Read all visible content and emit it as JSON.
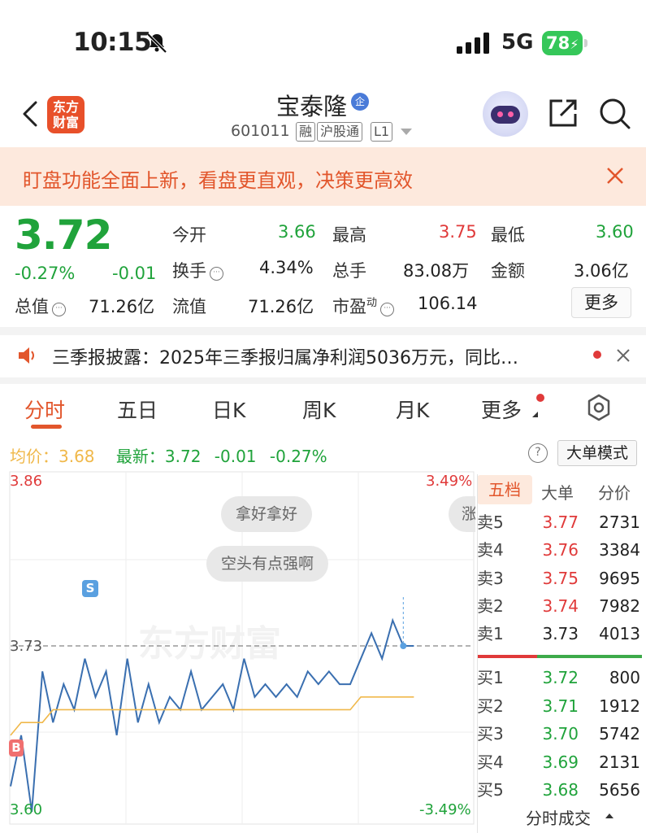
{
  "status_bar": {
    "time": "10:15",
    "network": "5G",
    "battery": "78"
  },
  "header": {
    "logo_text_line1": "东方",
    "logo_text_line2": "财富",
    "stock_name": "宝泰隆",
    "name_badge": "企",
    "stock_code": "601011",
    "tags": [
      "融",
      "沪股通",
      "L1"
    ]
  },
  "banner": {
    "text": "盯盘功能全面上新，看盘更直观，决策更高效"
  },
  "quote": {
    "price": "3.72",
    "change_pct": "-0.27%",
    "change": "-0.01",
    "open_label": "今开",
    "open": "3.66",
    "high_label": "最高",
    "high": "3.75",
    "low_label": "最低",
    "low": "3.60",
    "turnover_label": "换手",
    "turnover": "4.34%",
    "volume_label": "总手",
    "volume": "83.08万",
    "amount_label": "金额",
    "amount": "3.06亿",
    "total_cap_label": "总值",
    "total_cap": "71.26亿",
    "float_cap_label": "流值",
    "float_cap": "71.26亿",
    "pe_label": "市盈",
    "pe_sup": "动",
    "pe": "106.14",
    "more_label": "更多"
  },
  "notice": {
    "text": "三季报披露：2025年三季报归属净利润5036万元，同比…"
  },
  "tabs": [
    "分时",
    "五日",
    "日K",
    "周K",
    "月K",
    "更多"
  ],
  "chart_header": {
    "avg_label": "均价：",
    "avg": "3.68",
    "latest_label": "最新：",
    "latest": "3.72",
    "latest_change": "-0.01",
    "latest_pct": "-0.27%",
    "help": "?",
    "mode_button": "大单模式"
  },
  "chart_labels": {
    "top_price": "3.86",
    "top_pct": "3.49%",
    "bottom_price": "3.60",
    "bottom_pct": "-3.49%",
    "ref_price": "3.73",
    "bubble1": "拿好拿好",
    "bubble2": "空头有点强啊",
    "bubble3": "涨",
    "watermark": "东方财富",
    "sell_marker": "S",
    "buy_marker": "B"
  },
  "order_book": {
    "tabs": [
      "五档",
      "大单",
      "分价"
    ],
    "asks": [
      {
        "label": "卖5",
        "price": "3.77",
        "vol": "2731"
      },
      {
        "label": "卖4",
        "price": "3.76",
        "vol": "3384"
      },
      {
        "label": "卖3",
        "price": "3.75",
        "vol": "9695"
      },
      {
        "label": "卖2",
        "price": "3.74",
        "vol": "7982"
      },
      {
        "label": "卖1",
        "price": "3.73",
        "vol": "4013"
      }
    ],
    "bids": [
      {
        "label": "买1",
        "price": "3.72",
        "vol": "800"
      },
      {
        "label": "买2",
        "price": "3.71",
        "vol": "1912"
      },
      {
        "label": "买3",
        "price": "3.70",
        "vol": "5742"
      },
      {
        "label": "买4",
        "price": "3.69",
        "vol": "2131"
      },
      {
        "label": "买5",
        "price": "3.68",
        "vol": "5656"
      }
    ],
    "footer": "分时成交"
  },
  "chart_data": {
    "type": "line",
    "ylim": [
      3.6,
      3.86
    ],
    "reference_price": 3.73,
    "series": [
      {
        "values": [
          3.62,
          3.66,
          3.6,
          3.71,
          3.67,
          3.7,
          3.68,
          3.72,
          3.69,
          3.71,
          3.66,
          3.72,
          3.67,
          3.7,
          3.67,
          3.69,
          3.68,
          3.71,
          3.68,
          3.69,
          3.7,
          3.68,
          3.72,
          3.69,
          3.7,
          3.69,
          3.7,
          3.69,
          3.71,
          3.7,
          3.71,
          3.7,
          3.7,
          3.72,
          3.74,
          3.72,
          3.75,
          3.73,
          3.73
        ]
      },
      {
        "values": [
          3.66,
          3.67,
          3.67,
          3.67,
          3.68,
          3.68,
          3.68,
          3.68,
          3.68,
          3.68,
          3.68,
          3.68,
          3.68,
          3.68,
          3.68,
          3.68,
          3.68,
          3.68,
          3.68,
          3.68,
          3.68,
          3.68,
          3.68,
          3.68,
          3.68,
          3.68,
          3.68,
          3.68,
          3.68,
          3.68,
          3.68,
          3.68,
          3.68,
          3.69,
          3.69,
          3.69,
          3.69,
          3.69,
          3.69
        ]
      }
    ],
    "total_minutes": 240,
    "elapsed_points": 39,
    "colors": {
      "price": "#3a6fb0",
      "avg": "#f0b84a"
    }
  }
}
